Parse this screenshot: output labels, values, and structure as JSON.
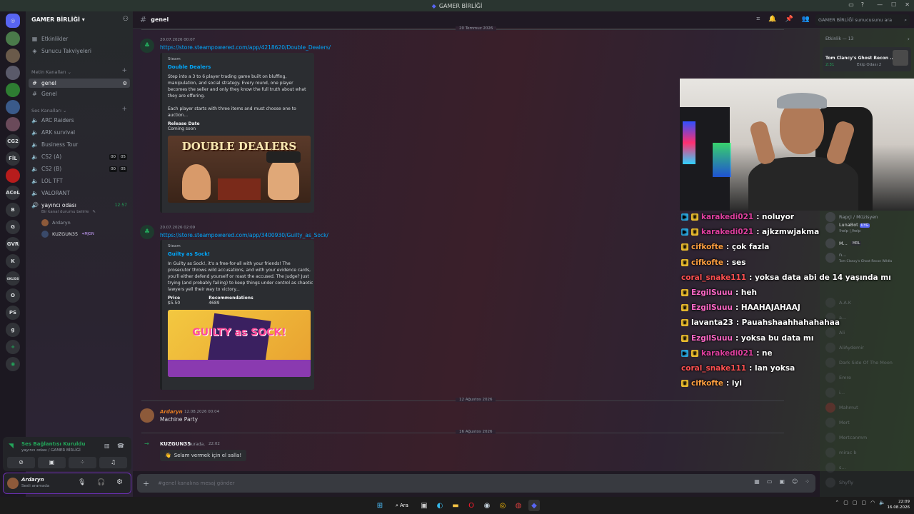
{
  "window": {
    "title": "GAMER BİRLİĞİ"
  },
  "server": {
    "name": "GAMER BİRLİĞİ"
  },
  "guilds": [
    "CG2",
    "FİL",
    "ACeL",
    "B",
    "G",
    "GVR",
    "K",
    "OKLİDS",
    "O",
    "PS",
    "g"
  ],
  "sidebar": {
    "top_items": [
      "Etkinlikler",
      "Sunucu Takviyeleri"
    ],
    "text_category": "Metin Kanalları",
    "text_channels": [
      "genel",
      "Genel"
    ],
    "voice_category": "Ses Kanalları",
    "voice_channels": [
      "ARC Raiders",
      "ARK survival",
      "Business Tour",
      "CS2 (A)",
      "CS2 (B)",
      "LOL TFT",
      "VALORANT"
    ],
    "cs2a_counts": [
      "00",
      "05"
    ],
    "cs2b_counts": [
      "00",
      "05"
    ],
    "stream_channel": "yayıncı odası",
    "stream_time": "12:57",
    "stream_status": "Bir kanal durumu belirle",
    "voice_users": [
      "Ardaryn",
      "KUZGUN35"
    ],
    "voice_user_tag": "MJGN"
  },
  "voice_panel": {
    "status": "Ses Bağlantısı Kuruldu",
    "location": "yayıncı odası / GAMER BİRLİĞİ"
  },
  "user_panel": {
    "name": "Ardaryn",
    "status": "Sesli aramada"
  },
  "chat": {
    "channel": "genel",
    "top_divider": "20 Temmuz 2026",
    "msg1": {
      "time": "20.07.2026 00:07",
      "url": "https://store.steampowered.com/app/4218620/Double_Dealers/",
      "provider": "Steam",
      "title": "Double Dealers",
      "desc": "Step into a 3 to 6 player trading game built on bluffing, manipulation, and social strategy. Every round, one player becomes the seller and only they know the full truth about what they are offering.\n\nEach player starts with three items and must choose one to auction...",
      "field_name": "Release Date",
      "field_value": "Coming soon",
      "image_text": "DOUBLE DEALERS"
    },
    "msg2": {
      "time": "20.07.2026 02:09",
      "url": "https://store.steampowered.com/app/3400930/Guilty_as_Sock/",
      "provider": "Steam",
      "title": "Guilty as Sock!",
      "desc": "In Guilty as Sock!, it's a free-for-all with your friends! The prosecutor throws wild accusations, and with your evidence cards, you'll either defend yourself or roast the accused. The judge? Just trying (and probably failing) to keep things under control as chaotic lawyers yell their way to victory...",
      "f1_name": "Price",
      "f1_value": "$5.50",
      "f2_name": "Recommendations",
      "f2_value": "4689",
      "image_text": "GUILTY as SOCK!"
    },
    "divider2": "12 Ağustos 2026",
    "msg3": {
      "author": "Ardaryn",
      "time": "12.08.2026 00:04",
      "text": "Machine Party"
    },
    "divider3": "16 Ağustos 2026",
    "msg4": {
      "author": "KUZGUN35",
      "suffix": "burada.",
      "time": "22:02",
      "wave": "Selam vermek için el salla!"
    },
    "composer_placeholder": "#genel kanalına mesaj gönder"
  },
  "header": {
    "search_placeholder": "GAMER BİRLİĞİ sunucusunu ara"
  },
  "members": {
    "activity_header": "Etkinlik — 13",
    "activity_game": "Tom Clancy's Ghost Recon ...",
    "activity_time": "2:31",
    "activity_channel": "Ekip Odası 2",
    "list": [
      {
        "name": "Rapçi / Müzisyen",
        "sub": ""
      },
      {
        "name": "LunaBot",
        "sub": "!help | /help",
        "tag": "UYG"
      },
      {
        "name": "M...",
        "sub": "",
        "tag": "MRL"
      },
      {
        "name": "n...",
        "sub": "Tom Clancy's Ghost Recon Wildla"
      },
      {
        "name": "A.A.K",
        "sub": ""
      },
      {
        "name": "a...",
        "sub": ""
      },
      {
        "name": "Ali",
        "sub": ""
      },
      {
        "name": "AliAydemir",
        "sub": ""
      },
      {
        "name": "Dark Side Of The Moon",
        "sub": ""
      },
      {
        "name": "Emre",
        "sub": ""
      },
      {
        "name": "i...",
        "sub": ""
      },
      {
        "name": "Mahmut",
        "sub": ""
      },
      {
        "name": "Mert",
        "sub": ""
      },
      {
        "name": "Mertcanmm",
        "sub": ""
      },
      {
        "name": "mirac b",
        "sub": ""
      },
      {
        "name": "s...",
        "sub": ""
      },
      {
        "name": "Shyfly",
        "sub": ""
      }
    ]
  },
  "stream_chat": [
    {
      "user": "karakedi021",
      "msg": ": noluyor",
      "color": "#e040a0",
      "badges": [
        "blue",
        "yellow"
      ]
    },
    {
      "user": "karakedi021",
      "msg": ": ajkzmwjakma",
      "color": "#e040a0",
      "badges": [
        "blue",
        "yellow"
      ]
    },
    {
      "user": "cifkofte",
      "msg": ": çok fazla",
      "color": "#ff9f40",
      "badges": [
        "yellow"
      ]
    },
    {
      "user": "cifkofte",
      "msg": ": ses",
      "color": "#ff9f40",
      "badges": [
        "yellow"
      ]
    },
    {
      "user": "coral_snake111",
      "msg": ": yoksa data abi de 14 yaşında mı",
      "color": "#ff5050",
      "badges": []
    },
    {
      "user": "EzgilSuuu",
      "msg": ": heh",
      "color": "#ff69c8",
      "badges": [
        "yellow"
      ]
    },
    {
      "user": "EzgilSuuu",
      "msg": ": HAAHAJAHAAJ",
      "color": "#ff69c8",
      "badges": [
        "yellow"
      ]
    },
    {
      "user": "lavanta23",
      "msg": ": Pauahshaahhahahahaa",
      "color": "#ffffff",
      "badges": [
        "yellow"
      ]
    },
    {
      "user": "EzgilSuuu",
      "msg": ": yoksa bu data mı",
      "color": "#ff69c8",
      "badges": [
        "yellow"
      ]
    },
    {
      "user": "karakedi021",
      "msg": ": ne",
      "color": "#e040a0",
      "badges": [
        "blue",
        "yellow"
      ]
    },
    {
      "user": "coral_snake111",
      "msg": ": lan yoksa",
      "color": "#ff5050",
      "badges": []
    },
    {
      "user": "cifkofte",
      "msg": ": iyi",
      "color": "#ff9f40",
      "badges": [
        "yellow"
      ]
    }
  ],
  "taskbar": {
    "search": "Ara",
    "time": "22:09",
    "date": "16.08.2026"
  }
}
